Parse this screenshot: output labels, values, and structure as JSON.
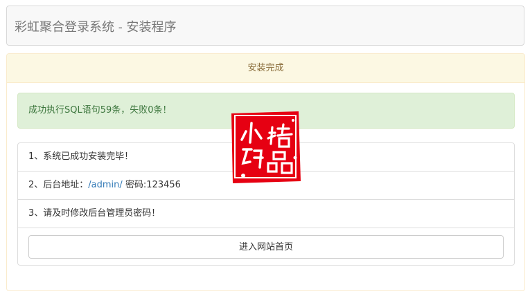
{
  "navbar": {
    "title": "彩虹聚合登录系统 - 安装程序"
  },
  "panel": {
    "heading": "安装完成"
  },
  "alert": {
    "message": "成功执行SQL语句59条，失败0条！"
  },
  "list": {
    "item1": "1、系统已成功安装完毕！",
    "item2_prefix": "2、后台地址：",
    "item2_link": "/admin/",
    "item2_suffix": " 密码:123456",
    "item3": "3、请及时修改后台管理员密码！"
  },
  "button": {
    "label": "进入网站首页"
  },
  "watermark": {
    "text": "小码精品",
    "color": "#e60012"
  }
}
